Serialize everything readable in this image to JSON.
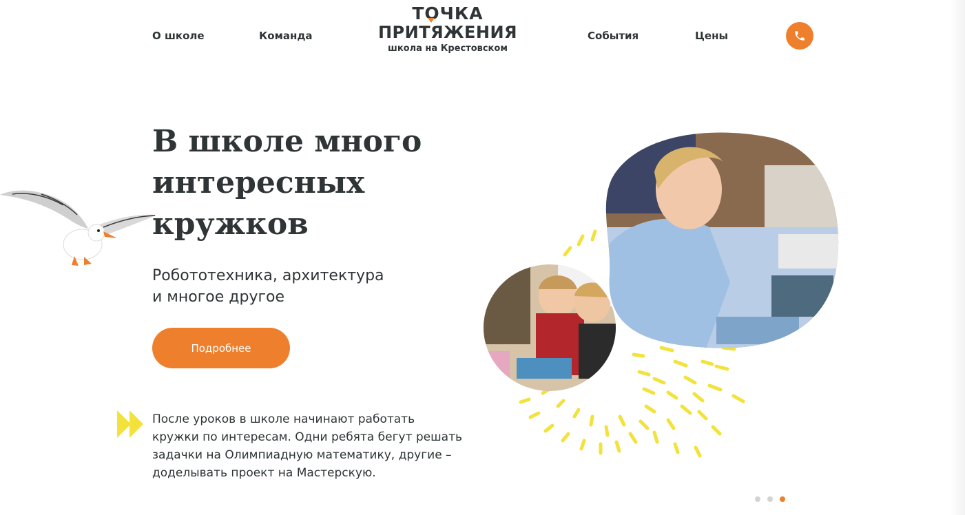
{
  "header": {
    "nav_left": [
      "О школе",
      "Команда"
    ],
    "nav_right": [
      "События",
      "Цены"
    ],
    "logo": {
      "line1": "ТОЧКА",
      "line2": "ПРИТЯЖЕНИЯ",
      "tagline": "школа на Крестовском"
    },
    "phone_icon": "phone-icon"
  },
  "hero": {
    "title_lines": [
      "В школе много",
      "интересных",
      "кружков"
    ],
    "subtitle_lines": [
      "Робототехника, архитектура",
      "и многое другое"
    ],
    "cta_label": "Подробнее"
  },
  "note": {
    "icon": "double-arrow-icon",
    "lines": [
      "После уроков в школе начинают работать",
      "кружки по интересам. Одни ребята бегут решать",
      "задачки на Олимпиадную математику, другие –",
      "доделывать проект на Мастерскую."
    ]
  },
  "slider": {
    "count": 3,
    "active_index": 2
  },
  "colors": {
    "accent": "#ee7f2d",
    "text": "#2f3436",
    "yellow": "#f2e23b",
    "dot_inactive": "#d3d3d3"
  }
}
